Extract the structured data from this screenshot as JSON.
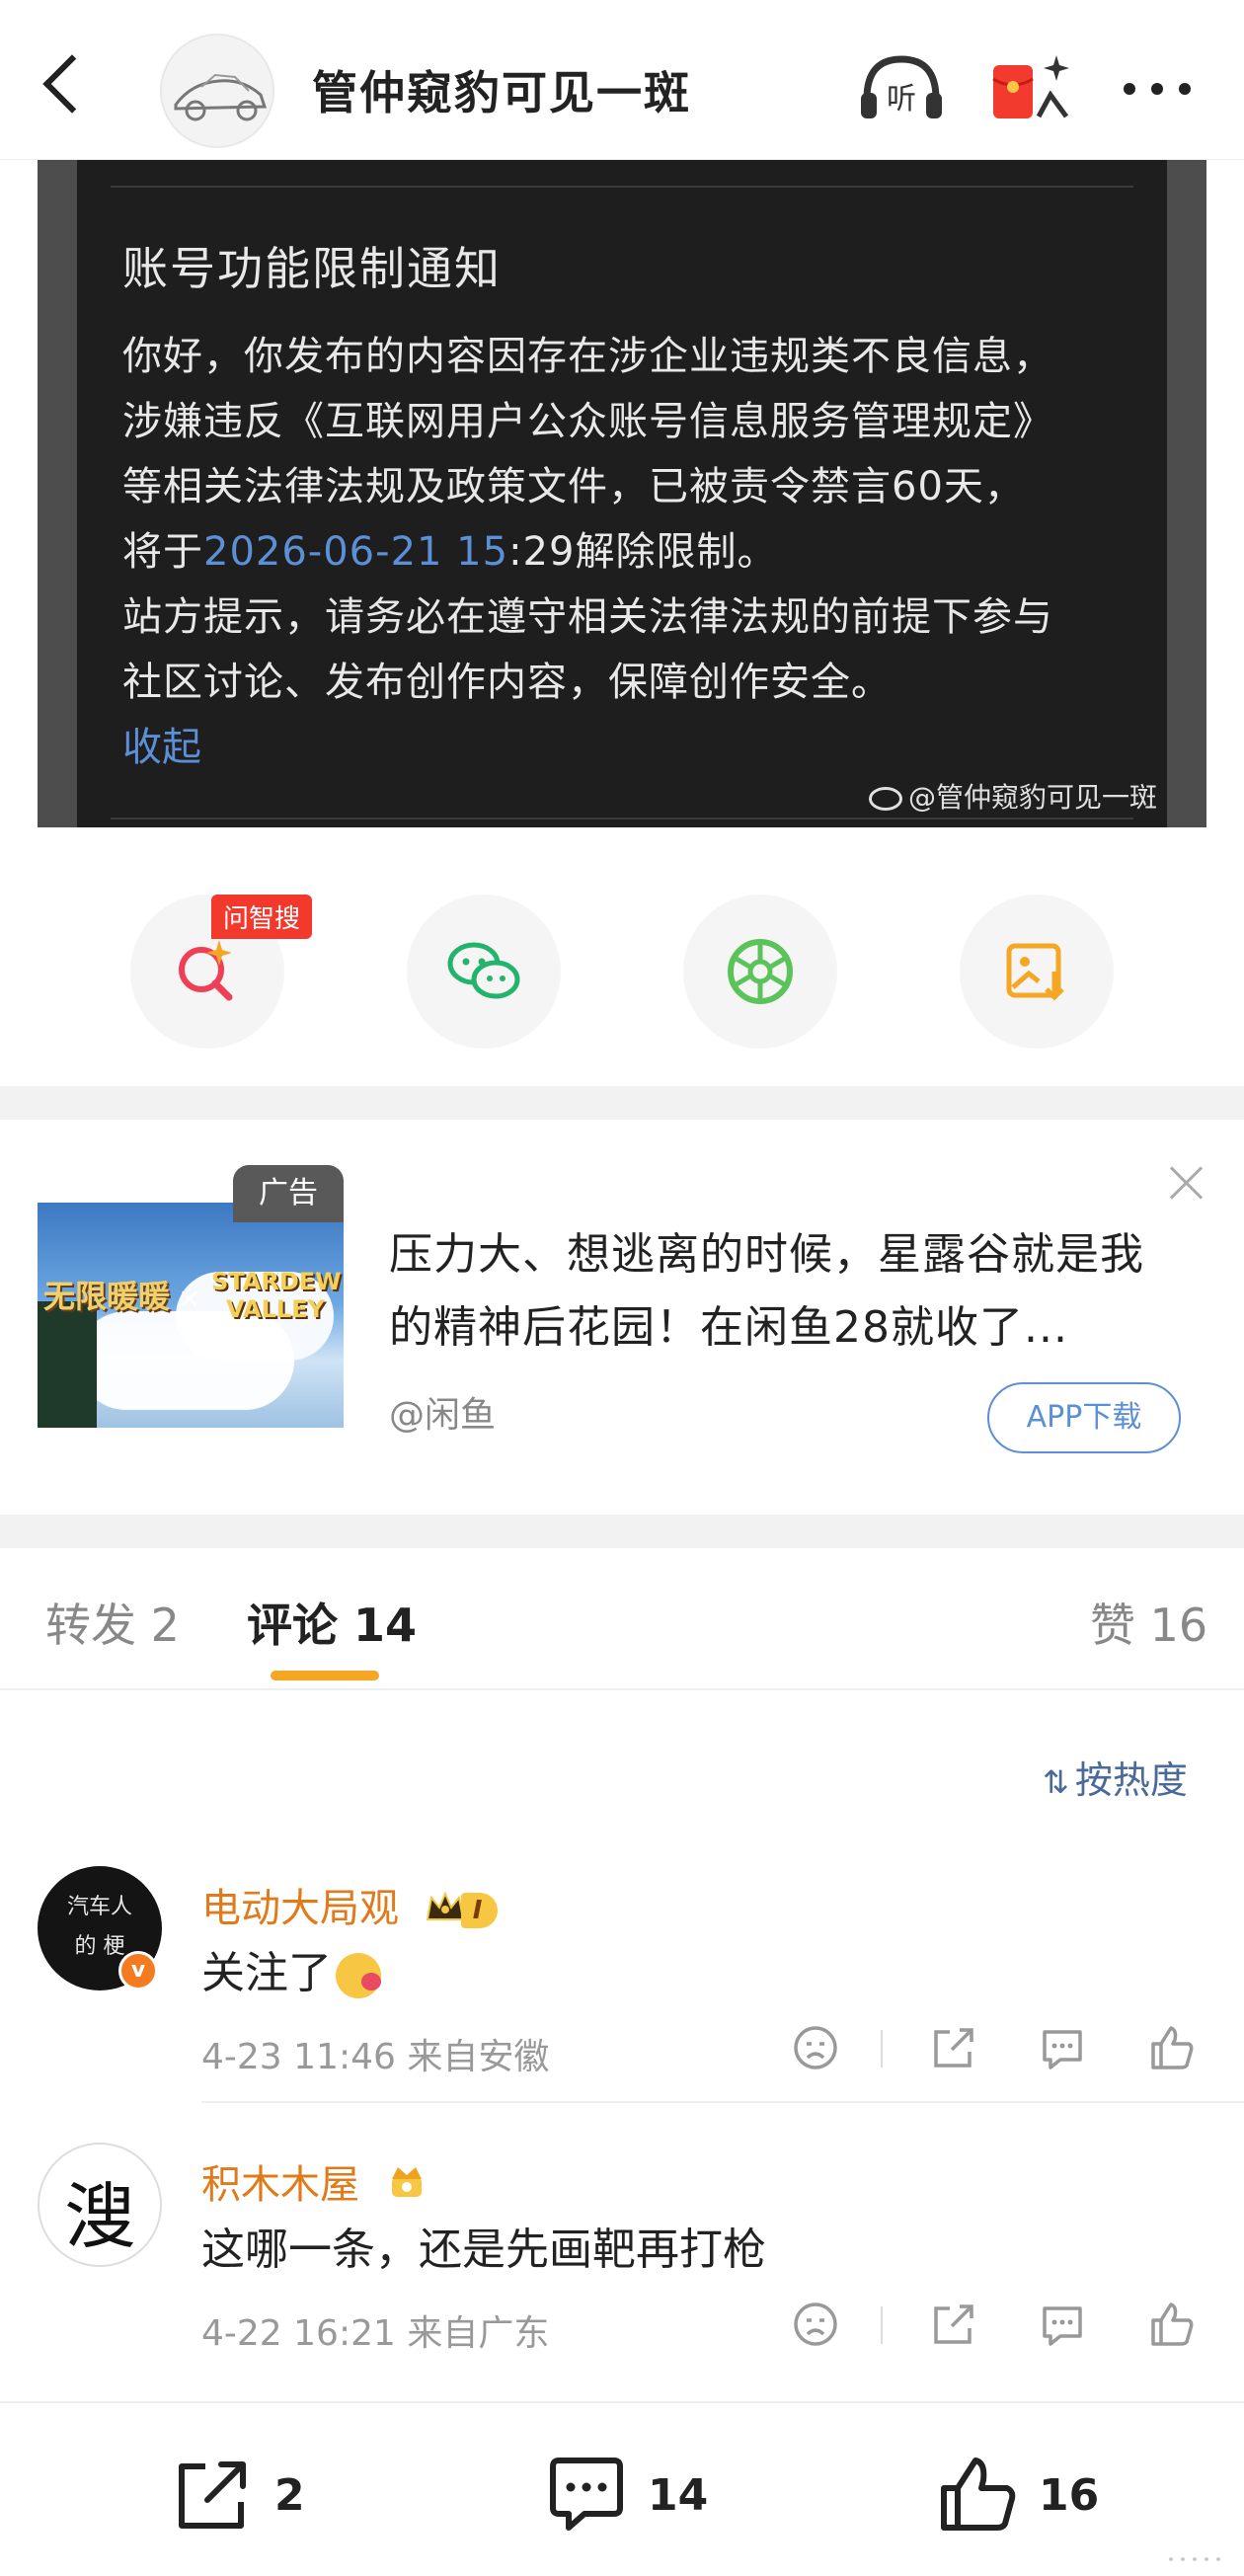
{
  "header": {
    "title": "管仲窥豹可见一斑"
  },
  "notice": {
    "title": "账号功能限制通知",
    "line1": "你好，你发布的内容因存在涉企业违规类不良信息，",
    "line2": "涉嫌违反《互联网用户公众账号信息服务管理规定》",
    "line3": "等相关法律法规及政策文件，已被责令禁言60天，",
    "line4_prefix": "将于",
    "line4_date": "2026-06-21 15",
    "line4_suffix": ":29解除限制。",
    "line5": "站方提示，请务必在遵守相关法律法规的前提下参与",
    "line6": "社区讨论、发布创作内容，保障创作安全。",
    "collapse_label": "收起",
    "watermark": "@管仲窥豹可见一斑"
  },
  "share": {
    "ask_badge": "问智搜"
  },
  "ad": {
    "label": "广告",
    "image_left_text": "无限暖暖",
    "image_x": "×",
    "image_right_text": "STARDEW VALLEY",
    "text": "压力大、想逃离的时候，星露谷就是我的精神后花园！在闲鱼28就收了...",
    "source": "@闲鱼",
    "button": "APP下载"
  },
  "tabs": [
    {
      "label": "转发 2"
    },
    {
      "label": "评论 14"
    },
    {
      "label": "赞 16"
    }
  ],
  "sort": {
    "icon": "sort-icon",
    "label": "按热度"
  },
  "comments": [
    {
      "avatar_text": "汽车人的 梗",
      "verified_badge": "v",
      "name": "电动大局观",
      "level": "I",
      "text": "关注了",
      "time": "4-23 11:46",
      "location": "来自安徽"
    },
    {
      "avatar_text": "溲",
      "name": "积木木屋",
      "text": "这哪一条，还是先画靶再打枪",
      "time": "4-22 16:21",
      "location": "来自广东"
    }
  ],
  "bottom": {
    "repost_count": "2",
    "comment_count": "14",
    "like_count": "16"
  },
  "colors": {
    "accent_orange": "#f5a623",
    "name_orange": "#e07a1b",
    "link_blue": "#5b8fd6",
    "ad_badge_red": "#f2392b"
  }
}
